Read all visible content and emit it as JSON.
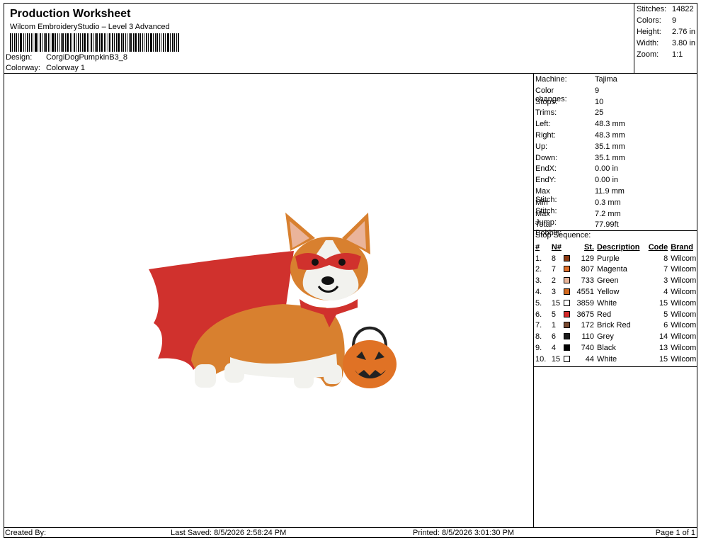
{
  "header": {
    "title": "Production Worksheet",
    "software": "Wilcom EmbroideryStudio – Level 3 Advanced",
    "design_label": "Design:",
    "design_value": "CorgiDogPumpkinB3_8",
    "colorway_label": "Colorway:",
    "colorway_value": "Colorway 1"
  },
  "stats": [
    {
      "k": "Stitches:",
      "v": "14822"
    },
    {
      "k": "Colors:",
      "v": "9"
    },
    {
      "k": "Height:",
      "v": "2.76 in"
    },
    {
      "k": "Width:",
      "v": "3.80 in"
    },
    {
      "k": "Zoom:",
      "v": "1:1"
    }
  ],
  "machine_info": [
    {
      "k": "Machine:",
      "v": "Tajima"
    },
    {
      "k": "Color changes:",
      "v": "9"
    },
    {
      "k": "Stops:",
      "v": "10"
    },
    {
      "k": "Trims:",
      "v": "25"
    },
    {
      "k": "Left:",
      "v": "48.3 mm"
    },
    {
      "k": "Right:",
      "v": "48.3 mm"
    },
    {
      "k": "Up:",
      "v": "35.1 mm"
    },
    {
      "k": "Down:",
      "v": "35.1 mm"
    },
    {
      "k": "EndX:",
      "v": "0.00 in"
    },
    {
      "k": "EndY:",
      "v": "0.00 in"
    },
    {
      "k": "Max Stitch:",
      "v": "11.9 mm"
    },
    {
      "k": "Min Stitch:",
      "v": "0.3 mm"
    },
    {
      "k": "Max Jump:",
      "v": "7.2 mm"
    },
    {
      "k": "Total Bobbin:",
      "v": "77.99ft"
    }
  ],
  "stop_sequence": {
    "title": "Stop Sequence:",
    "headers": [
      "#",
      "N#",
      "St.",
      "Description",
      "Code",
      "Brand"
    ],
    "rows": [
      {
        "n": "1.",
        "needle": "8",
        "color": "#8b3a12",
        "st": "129",
        "desc": "Purple",
        "code": "8",
        "brand": "Wilcom"
      },
      {
        "n": "2.",
        "needle": "7",
        "color": "#e0702a",
        "st": "807",
        "desc": "Magenta",
        "code": "7",
        "brand": "Wilcom"
      },
      {
        "n": "3.",
        "needle": "2",
        "color": "#e8b49a",
        "st": "733",
        "desc": "Green",
        "code": "3",
        "brand": "Wilcom"
      },
      {
        "n": "4.",
        "needle": "3",
        "color": "#d2691e",
        "st": "4551",
        "desc": "Yellow",
        "code": "4",
        "brand": "Wilcom"
      },
      {
        "n": "5.",
        "needle": "15",
        "color": "#ffffff",
        "st": "3859",
        "desc": "White",
        "code": "15",
        "brand": "Wilcom"
      },
      {
        "n": "6.",
        "needle": "5",
        "color": "#d42a2a",
        "st": "3675",
        "desc": "Red",
        "code": "5",
        "brand": "Wilcom"
      },
      {
        "n": "7.",
        "needle": "1",
        "color": "#7a4a30",
        "st": "172",
        "desc": "Brick Red",
        "code": "6",
        "brand": "Wilcom"
      },
      {
        "n": "8.",
        "needle": "6",
        "color": "#1a1a1a",
        "st": "110",
        "desc": "Grey",
        "code": "14",
        "brand": "Wilcom"
      },
      {
        "n": "9.",
        "needle": "4",
        "color": "#000000",
        "st": "740",
        "desc": "Black",
        "code": "13",
        "brand": "Wilcom"
      },
      {
        "n": "10.",
        "needle": "15",
        "color": "#ffffff",
        "st": "44",
        "desc": "White",
        "code": "15",
        "brand": "Wilcom"
      }
    ]
  },
  "footer": {
    "created_by": "Created By:",
    "last_saved": "Last Saved: 8/5/2026 2:58:24 PM",
    "printed": "Printed: 8/5/2026 3:01:30 PM",
    "page": "Page 1 of 1"
  }
}
